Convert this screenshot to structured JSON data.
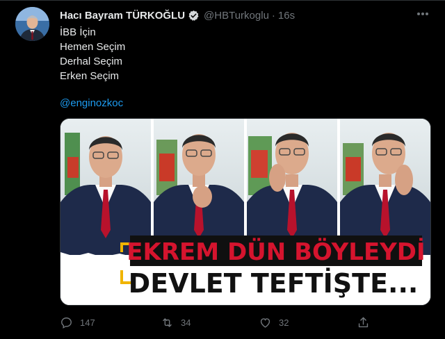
{
  "tweet": {
    "author_name": "Hacı Bayram TÜRKOĞLU",
    "handle": "@HBTurkoglu",
    "separator": "·",
    "time": "16s",
    "text_lines": [
      "İBB İçin",
      "Hemen Seçim",
      "Derhal Seçim",
      "Erken Seçim"
    ],
    "mention": "@enginozkoc"
  },
  "media": {
    "headline_1": "EKREM DÜN BÖYLEYDİ",
    "headline_2": "DEVLET TEFTİŞTE..."
  },
  "actions": {
    "replies": "147",
    "retweets": "34",
    "likes": "32"
  },
  "colors": {
    "background": "#000000",
    "link": "#1d9bf0",
    "muted": "#71767b",
    "headline_red": "#d5142e",
    "headline_frame": "#f0b400"
  },
  "icons": [
    "verified-badge-icon",
    "more-icon",
    "reply-icon",
    "retweet-icon",
    "like-icon",
    "share-icon"
  ]
}
